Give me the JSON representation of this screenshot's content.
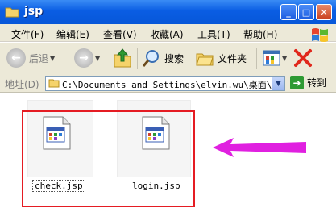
{
  "window": {
    "title": "jsp",
    "buttons": {
      "minimize": "_",
      "maximize": "□",
      "close": "✕"
    }
  },
  "menu": {
    "items": [
      "文件(F)",
      "编辑(E)",
      "查看(V)",
      "收藏(A)",
      "工具(T)",
      "帮助(H)"
    ]
  },
  "toolbar": {
    "back_label": "后退",
    "search_label": "搜索",
    "folders_label": "文件夹"
  },
  "address": {
    "label": "地址(D)",
    "path": "C:\\Documents and Settings\\elvin.wu\\桌面\\jsp",
    "go_label": "转到"
  },
  "files": [
    {
      "name": "check.jsp"
    },
    {
      "name": "login.jsp"
    }
  ],
  "colors": {
    "highlight_frame": "#e51c23",
    "pointer_arrow": "#e020e0"
  }
}
